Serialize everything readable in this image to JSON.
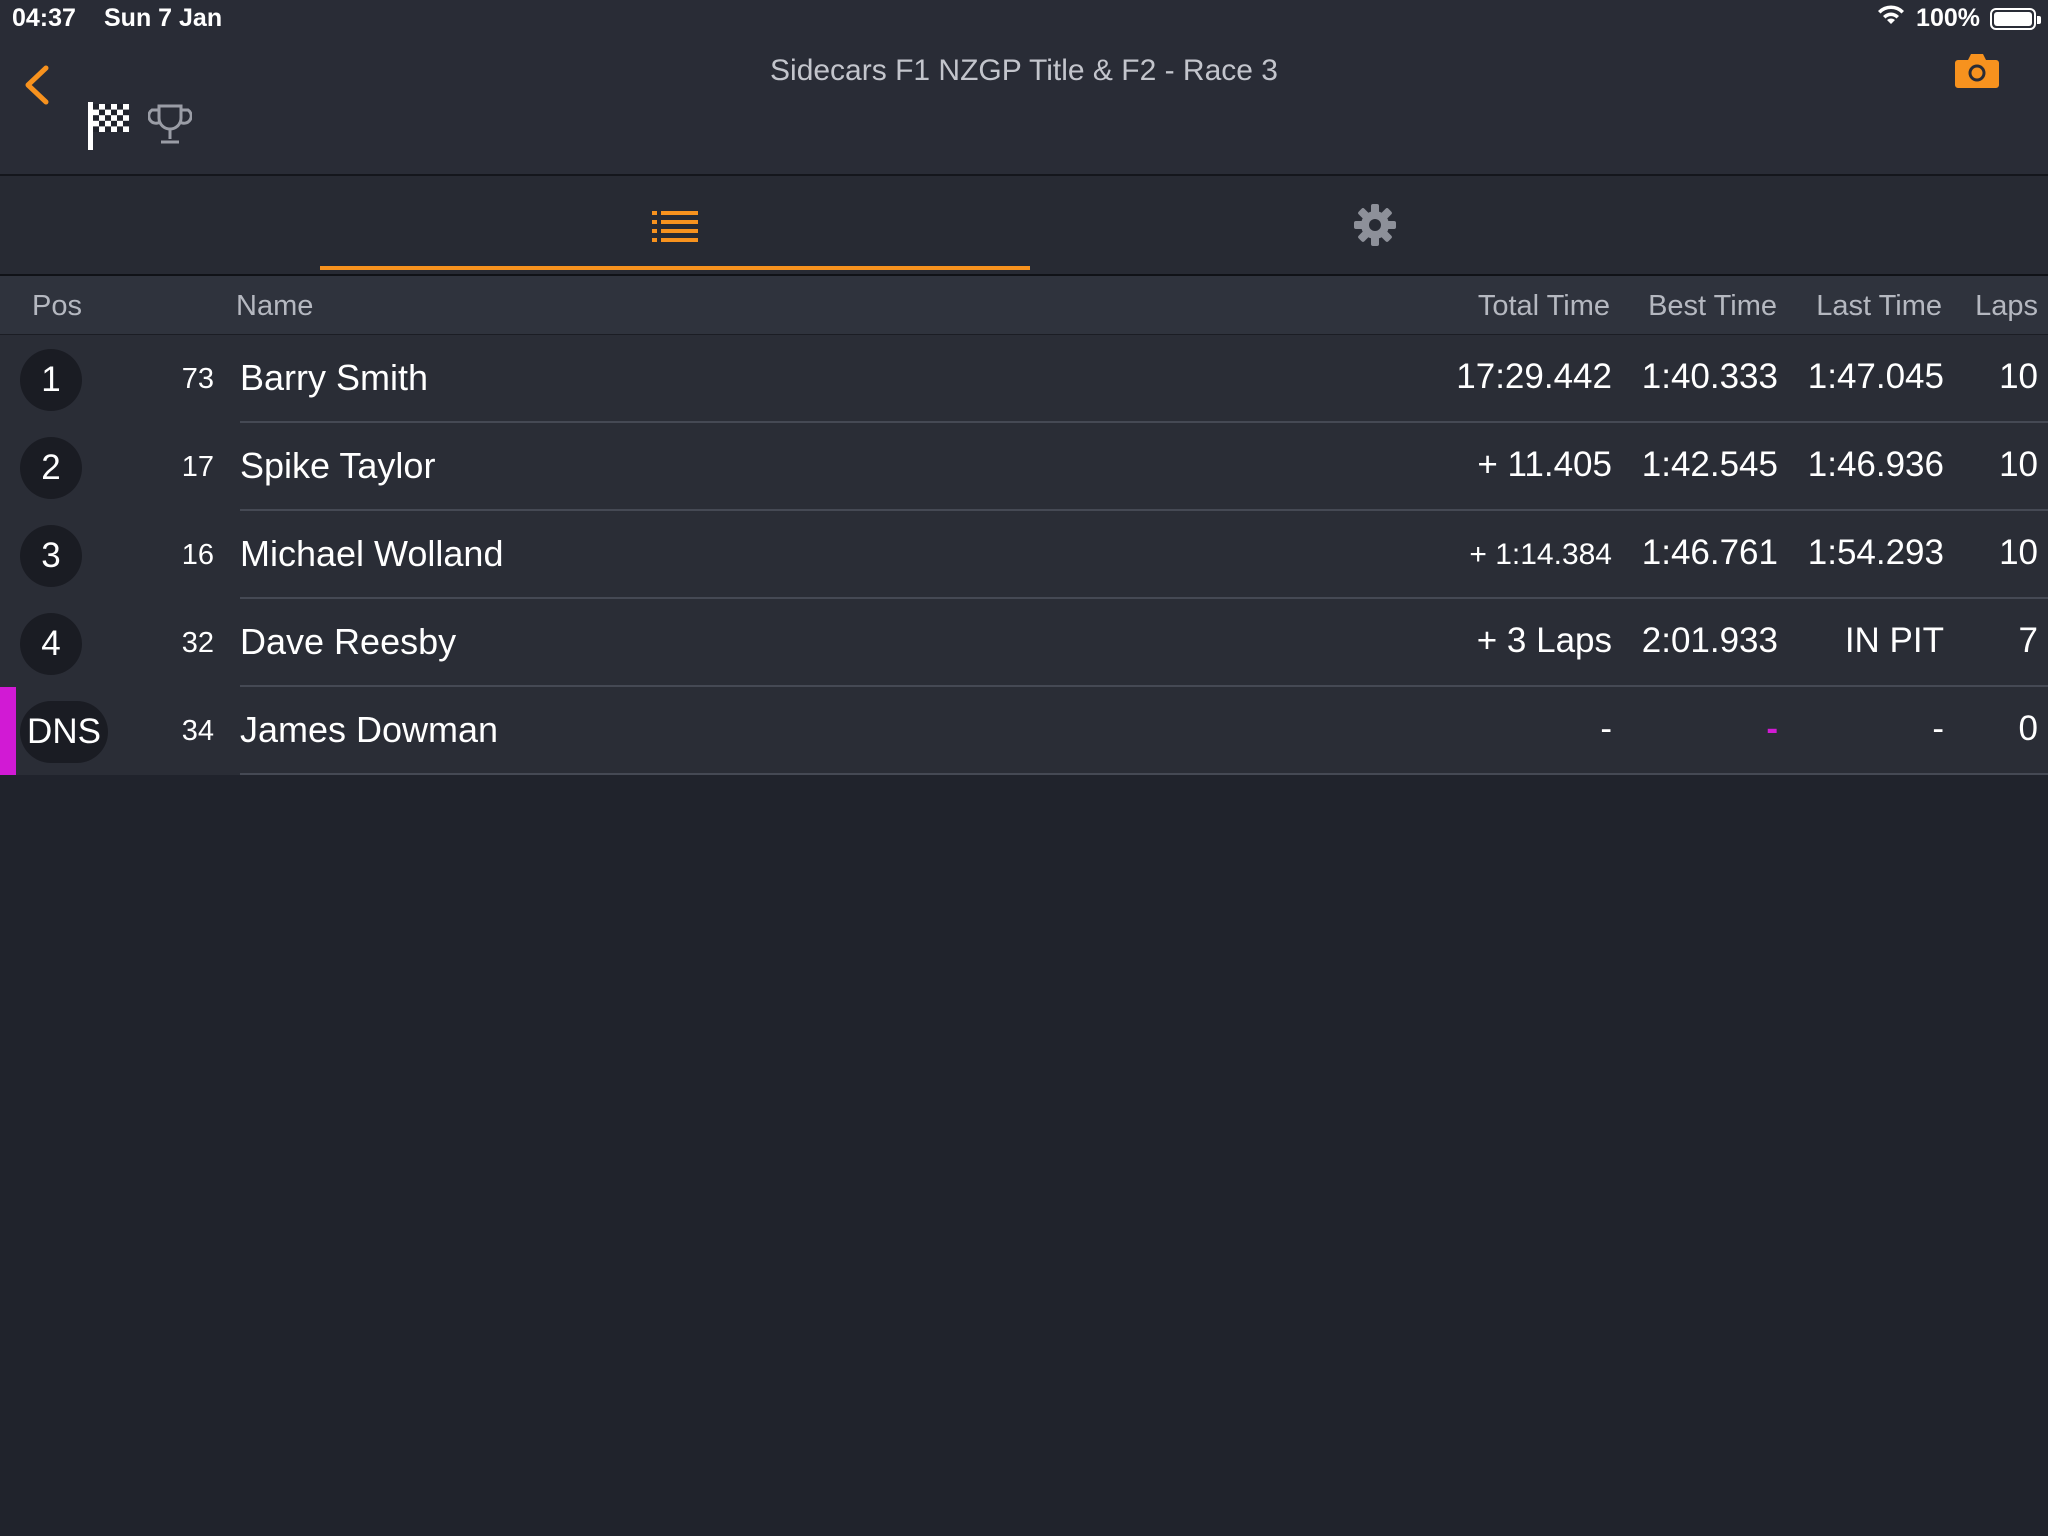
{
  "status_bar": {
    "time": "04:37",
    "date": "Sun 7 Jan",
    "battery": "100%"
  },
  "nav": {
    "title": "Sidecars F1 NZGP Title & F2 - Race 3",
    "accent_color": "#f7921e"
  },
  "tabs": [
    {
      "icon": "list-icon",
      "selected": true
    },
    {
      "icon": "gear-icon",
      "selected": false
    }
  ],
  "table": {
    "headers": {
      "pos": "Pos",
      "name": "Name",
      "total_time": "Total Time",
      "best_time": "Best Time",
      "last_time": "Last Time",
      "laps": "Laps"
    },
    "rows": [
      {
        "pos": "1",
        "number": "73",
        "name": "Barry Smith",
        "total": "17:29.442",
        "best": "1:40.333",
        "last": "1:47.045",
        "laps": "10"
      },
      {
        "pos": "2",
        "number": "17",
        "name": "Spike Taylor",
        "total": "+ 11.405",
        "best": "1:42.545",
        "last": "1:46.936",
        "laps": "10"
      },
      {
        "pos": "3",
        "number": "16",
        "name": "Michael Wolland",
        "total": "+ 1:14.384",
        "best": "1:46.761",
        "last": "1:54.293",
        "laps": "10"
      },
      {
        "pos": "4",
        "number": "32",
        "name": "Dave Reesby",
        "total": "+ 3 Laps",
        "best": "2:01.933",
        "last": "IN PIT",
        "laps": "7"
      },
      {
        "pos": "DNS",
        "number": "34",
        "name": "James Dowman",
        "total": "-",
        "best": "-",
        "last": "-",
        "laps": "0",
        "status_color": "#d11ad4"
      }
    ]
  }
}
